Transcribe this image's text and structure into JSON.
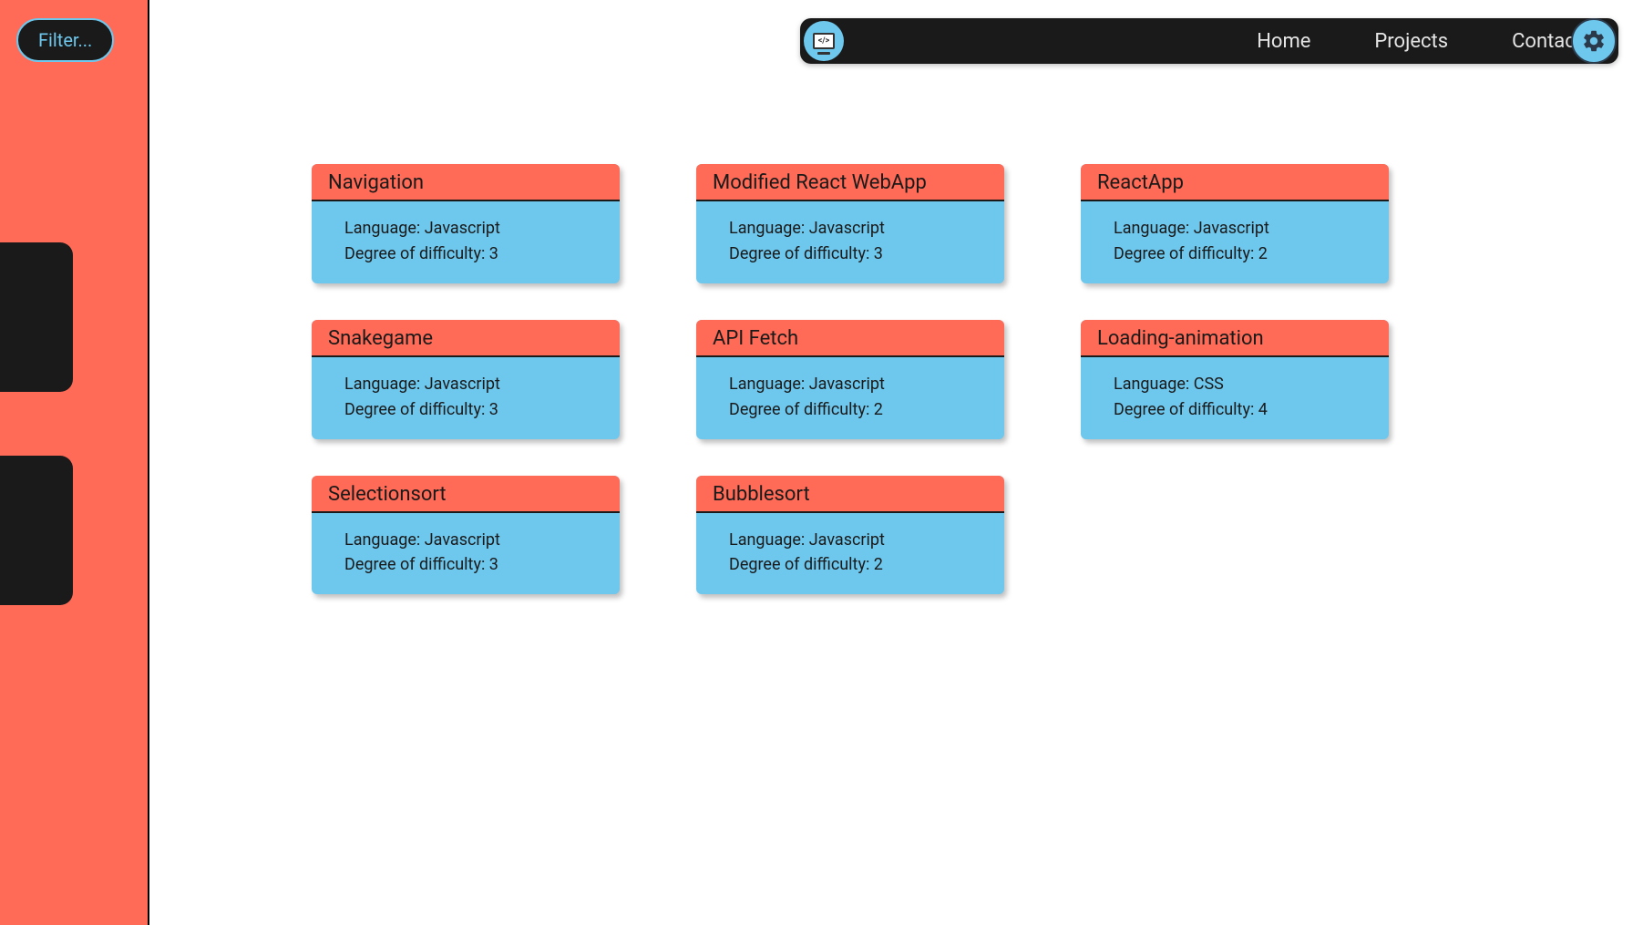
{
  "sidebar": {
    "filter_label": "Filter..."
  },
  "topbar": {
    "nav": {
      "home": "Home",
      "projects": "Projects",
      "contact": "Contact"
    }
  },
  "labels": {
    "language_prefix": "Language: ",
    "difficulty_prefix": "Degree of difficulty: "
  },
  "cards": [
    {
      "title": "Navigation",
      "language": "Javascript",
      "difficulty": "3"
    },
    {
      "title": "Modified React WebApp",
      "language": "Javascript",
      "difficulty": "3"
    },
    {
      "title": "ReactApp",
      "language": "Javascript",
      "difficulty": "2"
    },
    {
      "title": "Snakegame",
      "language": "Javascript",
      "difficulty": "3"
    },
    {
      "title": "API Fetch",
      "language": "Javascript",
      "difficulty": "2"
    },
    {
      "title": "Loading-animation",
      "language": "CSS",
      "difficulty": "4"
    },
    {
      "title": "Selectionsort",
      "language": "Javascript",
      "difficulty": "3"
    },
    {
      "title": "Bubblesort",
      "language": "Javascript",
      "difficulty": "2"
    }
  ]
}
